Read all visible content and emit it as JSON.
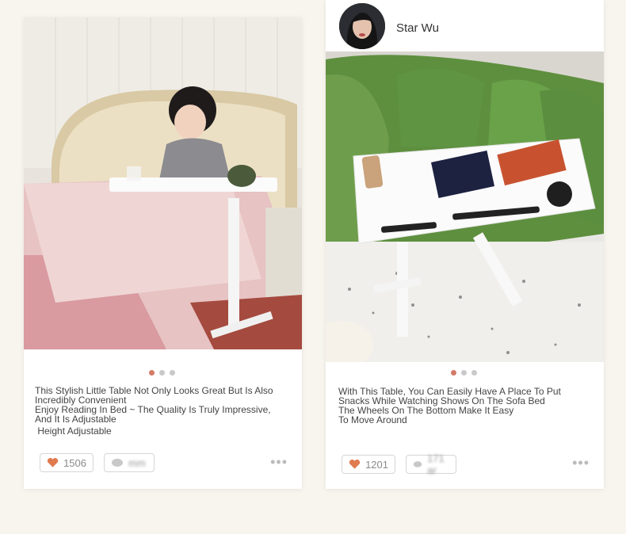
{
  "posts": [
    {
      "image_description": "white adjustable over-bed table beside a bed",
      "dots": [
        true,
        false,
        false
      ],
      "caption_lines": [
        "This Stylish Little Table Not Only Looks Great But Is Also",
        "Incredibly Convenient",
        "Enjoy Reading In Bed ~ The Quality Is Truly Impressive,",
        "And It Is Adjustable",
        " Height Adjustable"
      ],
      "likes": "1506",
      "comments": "mm",
      "more": "•••",
      "icons": {
        "like": "heart-icon",
        "comment": "comment-icon"
      }
    },
    {
      "author": {
        "name": "Star Wu",
        "avatar": "avatar-icon"
      },
      "image_description": "white adjustable table in front of a green sofa",
      "dots": [
        true,
        false,
        false
      ],
      "caption_lines": [
        "With This Table, You Can Easily Have A Place To Put",
        "Snacks While Watching Shows On The Sofa Bed",
        "The Wheels On The Bottom Make It Easy",
        "To Move Around"
      ],
      "likes": "1201",
      "comments": "171 ar",
      "more": "•••",
      "icons": {
        "like": "heart-icon",
        "comment": "comment-icon"
      }
    }
  ],
  "colors": {
    "accent": "#d47b68",
    "heart": "#e07a4f",
    "background": "#f8f5ee"
  }
}
